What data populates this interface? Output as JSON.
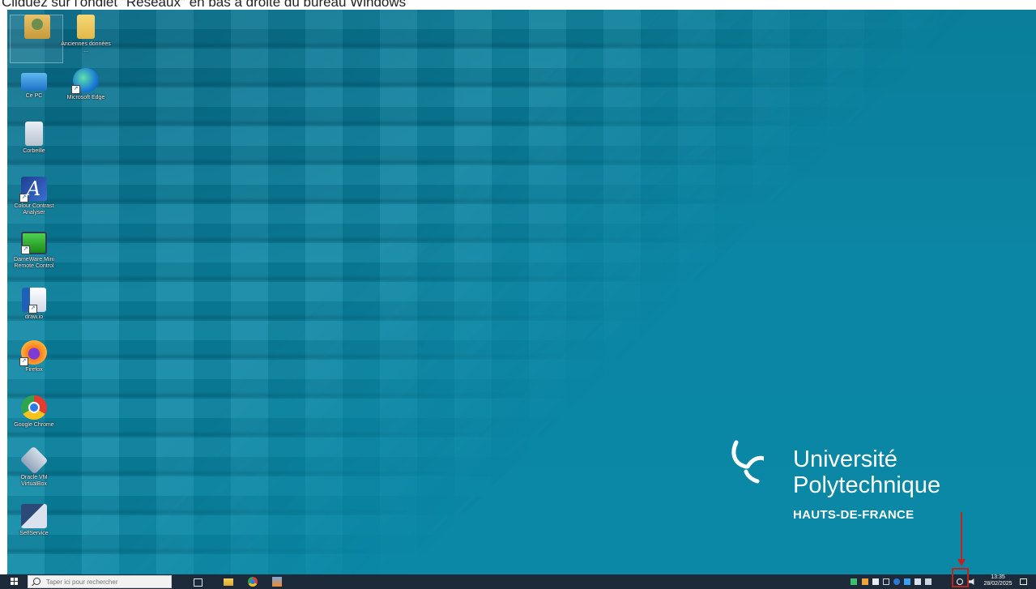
{
  "caption": "Cliquez sur l'onglet \"Réseaux\" en bas à droite du bureau Windows",
  "desktop_icons": [
    {
      "label": ""
    },
    {
      "label": "Anciennes données ..."
    },
    {
      "label": "Ce PC"
    },
    {
      "label": "Microsoft Edge"
    },
    {
      "label": "Corbeille"
    },
    {
      "label": "Colour Contrast Analyser"
    },
    {
      "label": "DameWare Mini Remote Control"
    },
    {
      "label": "draw.io"
    },
    {
      "label": "Firefox"
    },
    {
      "label": "Google Chrome"
    },
    {
      "label": "Oracle VM VirtualBox"
    },
    {
      "label": "SelfService"
    }
  ],
  "logo": {
    "name_line1": "Université",
    "name_line2": "Polytechnique",
    "subtitle": "HAUTS-DE-FRANCE"
  },
  "taskbar": {
    "search_placeholder": "Taper ici pour rechercher",
    "apps": [
      "task-view",
      "file-explorer",
      "google-chrome",
      "virtualbox"
    ],
    "tray": {
      "icons": [
        "hidden-icons",
        "app-green",
        "app-red",
        "onedrive",
        "usb",
        "bluetooth",
        "display",
        "folder",
        "mail",
        "network",
        "volume"
      ],
      "time": "13:35",
      "date": "28/02/2025"
    }
  },
  "colors": {
    "desktop": "#0a86a4",
    "taskbar": "#1c2a39",
    "annotation": "#c0231b"
  }
}
